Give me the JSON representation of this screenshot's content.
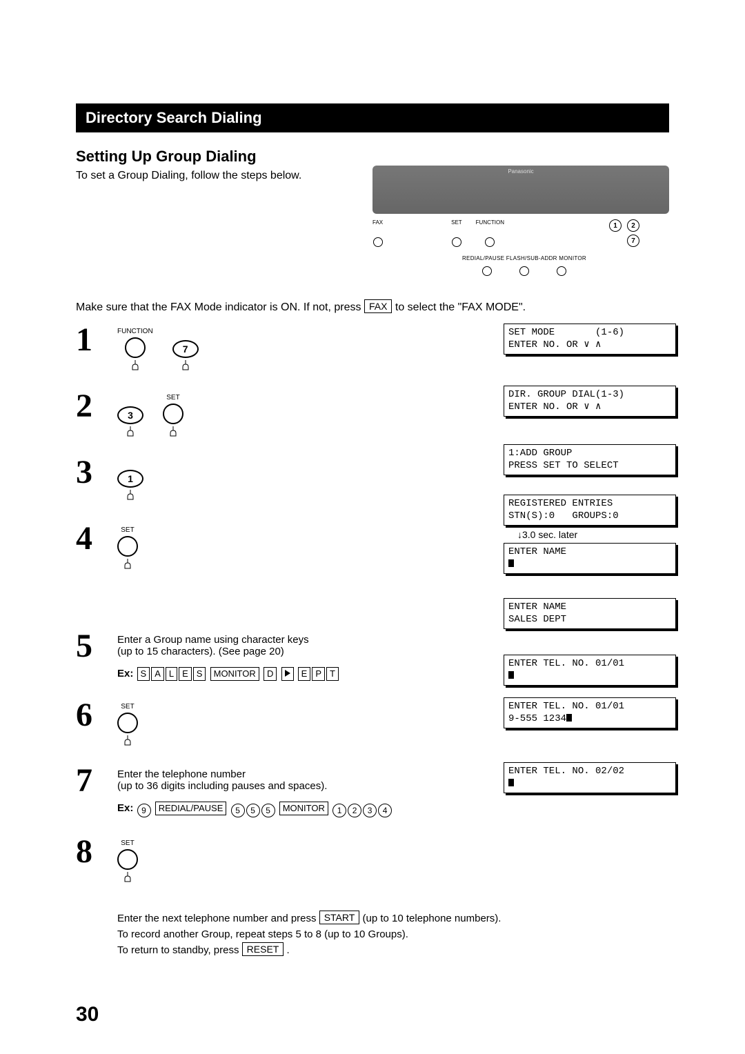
{
  "header": {
    "title": "Directory Search Dialing",
    "subtitle": "Setting Up Group Dialing",
    "intro": "To set a Group Dialing, follow the steps below."
  },
  "panel": {
    "brand": "Panasonic",
    "fax_label": "FAX",
    "set_label": "SET",
    "function_label": "FUNCTION",
    "callout_1": "1",
    "callout_2": "2",
    "callout_7": "7",
    "row2_label": "REDIAL/PAUSE  FLASH/SUB-ADDR  MONITOR"
  },
  "fax_note": {
    "pre": "Make sure that the FAX Mode indicator is ON.  If not, press ",
    "key": "FAX",
    "post": " to select the \"FAX MODE\"."
  },
  "steps": {
    "s1": {
      "num": "1",
      "btn1_label": "FUNCTION",
      "btn2_text": "7"
    },
    "s2": {
      "num": "2",
      "btn1_text": "3",
      "btn2_label": "SET"
    },
    "s3": {
      "num": "3",
      "btn1_text": "1"
    },
    "s4": {
      "num": "4",
      "btn1_label": "SET"
    },
    "s5": {
      "num": "5",
      "line1": "Enter a Group name using character keys",
      "line2": "(up to 15 characters). (See page 20)",
      "ex_label": "Ex:",
      "ex_keys": [
        "S",
        "A",
        "L",
        "E",
        "S"
      ],
      "ex_mid": "MONITOR",
      "ex_keys2": [
        "D"
      ],
      "ex_keys3": [
        "E",
        "P",
        "T"
      ]
    },
    "s6": {
      "num": "6",
      "btn1_label": "SET"
    },
    "s7": {
      "num": "7",
      "line1": "Enter the telephone number",
      "line2": "(up to 36 digits including pauses and spaces).",
      "ex_label": "Ex:",
      "ex_d1": "9",
      "ex_k1": "REDIAL/PAUSE",
      "ex_d2": [
        "5",
        "5",
        "5"
      ],
      "ex_k2": "MONITOR",
      "ex_d3": [
        "1",
        "2",
        "3",
        "4"
      ]
    },
    "s8": {
      "num": "8",
      "btn1_label": "SET"
    }
  },
  "lcds": {
    "l1a": "SET MODE       (1-6)",
    "l1b": "ENTER NO. OR ∨ ∧",
    "l2a": "DIR. GROUP DIAL(1-3)",
    "l2b": "ENTER NO. OR ∨ ∧",
    "l3a": "1:ADD GROUP",
    "l3b": "PRESS SET TO SELECT",
    "l4a": "REGISTERED ENTRIES",
    "l4b": "STN(S):0   GROUPS:0",
    "later": "↓3.0 sec. later",
    "l4c": "ENTER NAME",
    "l5a": "ENTER NAME",
    "l5b": "SALES DEPT",
    "l6a": "ENTER TEL. NO. 01/01",
    "l7a": "ENTER TEL. NO. 01/01",
    "l7b": "9-555 1234",
    "l8a": "ENTER TEL. NO. 02/02"
  },
  "footer": {
    "line1_pre": "Enter the next telephone number and press ",
    "line1_key": "START",
    "line1_post": " (up to 10 telephone numbers).",
    "line2": "To record another Group, repeat steps 5 to 8 (up to 10 Groups).",
    "line3_pre": "To return to standby, press ",
    "line3_key": "RESET",
    "line3_post": "."
  },
  "page_number": "30"
}
